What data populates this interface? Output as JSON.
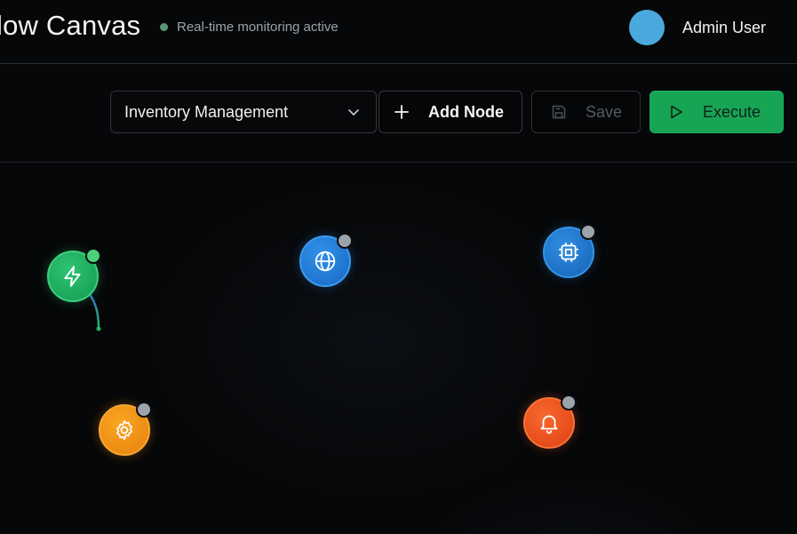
{
  "header": {
    "title": "low Canvas",
    "status_text": "Real-time monitoring active",
    "user_name": "Admin User"
  },
  "toolbar": {
    "workflow_select_value": "Inventory Management",
    "add_node_label": "Add Node",
    "save_label": "Save",
    "execute_label": "Execute"
  },
  "colors": {
    "accent_green": "#17a455",
    "status_dot": "#5a9677",
    "avatar": "#4aa8dc"
  },
  "nodes": [
    {
      "name": "trigger-node",
      "icon": "lightning-icon",
      "color": "#1aa058",
      "status": "active",
      "status_color": "#4cd17a"
    },
    {
      "name": "http-node",
      "icon": "globe-icon",
      "color": "#1e7fd6",
      "status": "idle",
      "status_color": "#9ca3ab"
    },
    {
      "name": "processor-node",
      "icon": "cpu-icon",
      "color": "#1d79cc",
      "status": "idle",
      "status_color": "#9ca3ab"
    },
    {
      "name": "settings-node",
      "icon": "gear-icon",
      "color": "#ef8f10",
      "status": "idle",
      "status_color": "#9ca3ab"
    },
    {
      "name": "notification-node",
      "icon": "bell-icon",
      "color": "#ea4a1c",
      "status": "idle",
      "status_color": "#9ca3ab"
    }
  ]
}
